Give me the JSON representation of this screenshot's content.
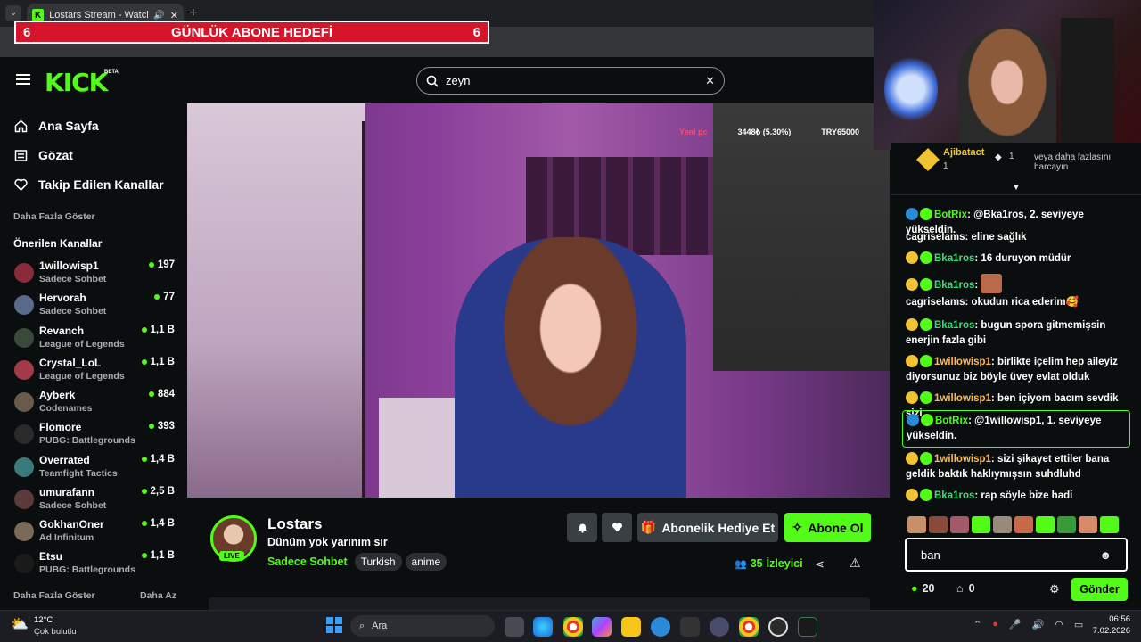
{
  "browser": {
    "tab_title": "Lostars Stream - Watch Live",
    "new_tab": "+"
  },
  "overlay": {
    "goal_left": "6",
    "goal_title": "GÜNLÜK ABONE HEDEFİ",
    "goal_right": "6"
  },
  "header": {
    "brand": "KICK",
    "beta": "BETA",
    "search_value": "zeyn"
  },
  "sidebar": {
    "nav": [
      {
        "label": "Ana Sayfa",
        "icon": "home-icon"
      },
      {
        "label": "Gözat",
        "icon": "browse-icon"
      },
      {
        "label": "Takip Edilen Kanallar",
        "icon": "heart-icon"
      }
    ],
    "show_more_top": "Daha Fazla Göster",
    "recommended_title": "Önerilen Kanallar",
    "channels": [
      {
        "name": "1willowisp1",
        "category": "Sadece Sohbet",
        "viewers": "197",
        "color": "#8a2a3a"
      },
      {
        "name": "Hervorah",
        "category": "Sadece Sohbet",
        "viewers": "77",
        "color": "#5a6a8a"
      },
      {
        "name": "Revanch",
        "category": "League of Legends",
        "viewers": "1,1 B",
        "color": "#3a4a3a"
      },
      {
        "name": "Crystal_LoL",
        "category": "League of Legends",
        "viewers": "1,1 B",
        "color": "#a23a4a"
      },
      {
        "name": "Ayberk",
        "category": "Codenames",
        "viewers": "884",
        "color": "#6a5a4a"
      },
      {
        "name": "Flomore",
        "category": "PUBG: Battlegrounds",
        "viewers": "393",
        "color": "#2a2a2a"
      },
      {
        "name": "Overrated",
        "category": "Teamfight Tactics",
        "viewers": "1,4 B",
        "color": "#3a7a7a"
      },
      {
        "name": "umurafann",
        "category": "Sadece Sohbet",
        "viewers": "2,5 B",
        "color": "#5a3a3a"
      },
      {
        "name": "GokhanOner",
        "category": "Ad Infinitum",
        "viewers": "1,4 B",
        "color": "#7a6a5a"
      },
      {
        "name": "Etsu",
        "category": "PUBG: Battlegrounds",
        "viewers": "1,1 B",
        "color": "#1a1a1a"
      }
    ],
    "show_more": "Daha Fazla Göster",
    "show_less": "Daha Az"
  },
  "video": {
    "overlay_left": "Yeni pc",
    "overlay_mid": "3448₺ (5.30%)",
    "overlay_right": "TRY65000"
  },
  "stream": {
    "streamer": "Lostars",
    "title": "Dünüm yok yarınım sır",
    "category": "Sadece Sohbet",
    "tags": [
      "Turkish",
      "anime"
    ],
    "live": "LIVE",
    "gift_label": "Abonelik Hediye Et",
    "subscribe_label": "Abone Ol",
    "viewers": "35",
    "viewers_label": "İzleyici"
  },
  "chat_top": {
    "user": "Ajibatact",
    "count": "1",
    "pinned_count": "1",
    "pinned_text": "veya daha fazlasını harcayın"
  },
  "chat": [
    {
      "user": "BotRix",
      "text": "@Bka1ros, 2. seviyeye yükseldin.",
      "cls": "u1"
    },
    {
      "user": "cagriselams",
      "text": "eline sağlık",
      "cls": "u3"
    },
    {
      "user": "Bka1ros",
      "text": "16 duruyon müdür",
      "cls": "u4"
    },
    {
      "user": "Bka1ros",
      "text": "",
      "cls": "u4"
    },
    {
      "user": "cagriselams",
      "text": "okudun rica ederim🥰",
      "cls": "u3"
    },
    {
      "user": "Bka1ros",
      "text": "bugun spora gitmemişsin enerjin fazla gibi",
      "cls": "u4"
    },
    {
      "user": "1willowisp1",
      "text": "birlikte içelim hep aileyiz diyorsunuz biz böyle üvey evlat olduk",
      "cls": "u2"
    },
    {
      "user": "1willowisp1",
      "text": "ben içiyom bacım sevdik sizi",
      "cls": "u2"
    },
    {
      "user": "BotRix",
      "text": "@1willowisp1, 1. seviyeye yükseldin.",
      "cls": "u1"
    },
    {
      "user": "1willowisp1",
      "text": "sizi şikayet ettiler bana geldik baktık haklıymışsın suhdluhd",
      "cls": "u2"
    },
    {
      "user": "Bka1ros",
      "text": "rap söyle bize hadi",
      "cls": "u4"
    }
  ],
  "chat_input": {
    "value": "ban"
  },
  "chat_footer": {
    "points": "20",
    "store": "0",
    "send": "Gönder"
  },
  "taskbar": {
    "weather_temp": "12°C",
    "weather_desc": "Çok bulutlu",
    "search": "Ara",
    "time": "06:56",
    "date": "7.02.2026"
  }
}
